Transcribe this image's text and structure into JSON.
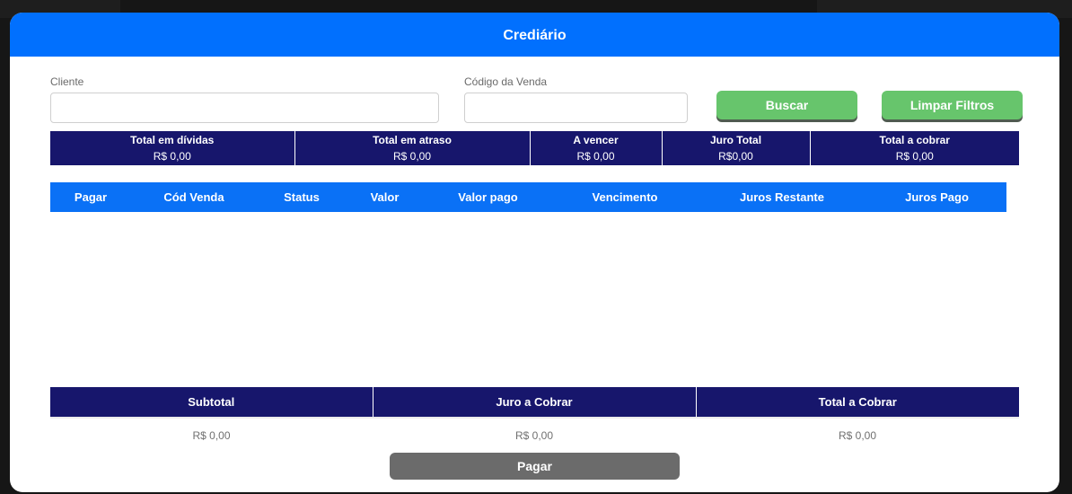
{
  "modal": {
    "title": "Crediário"
  },
  "filters": {
    "cliente": {
      "label": "Cliente",
      "value": "",
      "placeholder": ""
    },
    "codigo_venda": {
      "label": "Código da Venda",
      "value": "",
      "placeholder": ""
    },
    "buscar_label": "Buscar",
    "limpar_label": "Limpar Filtros",
    "button_color": "#67c56c"
  },
  "summary": [
    {
      "title": "Total em dívidas",
      "value": "R$ 0,00"
    },
    {
      "title": "Total em atraso",
      "value": "R$ 0,00"
    },
    {
      "title": "A vencer",
      "value": "R$ 0,00"
    },
    {
      "title": "Juro Total",
      "value": "R$0,00"
    },
    {
      "title": "Total a cobrar",
      "value": "R$ 0,00"
    }
  ],
  "grid": {
    "columns": [
      "Pagar",
      "Cód Venda",
      "Status",
      "Valor",
      "Valor pago",
      "Vencimento",
      "Juros Restante",
      "Juros Pago"
    ],
    "rows": []
  },
  "footer": {
    "headers": [
      "Subtotal",
      "Juro a Cobrar",
      "Total a Cobrar"
    ],
    "values": [
      "R$ 0,00",
      "R$ 0,00",
      "R$ 0,00"
    ]
  },
  "pay_button_label": "Pagar",
  "colors": {
    "header_blue": "#0170fe",
    "navy": "#17166c",
    "grid_header": "#0a71f6",
    "pay_button": "#6b6b6b"
  }
}
